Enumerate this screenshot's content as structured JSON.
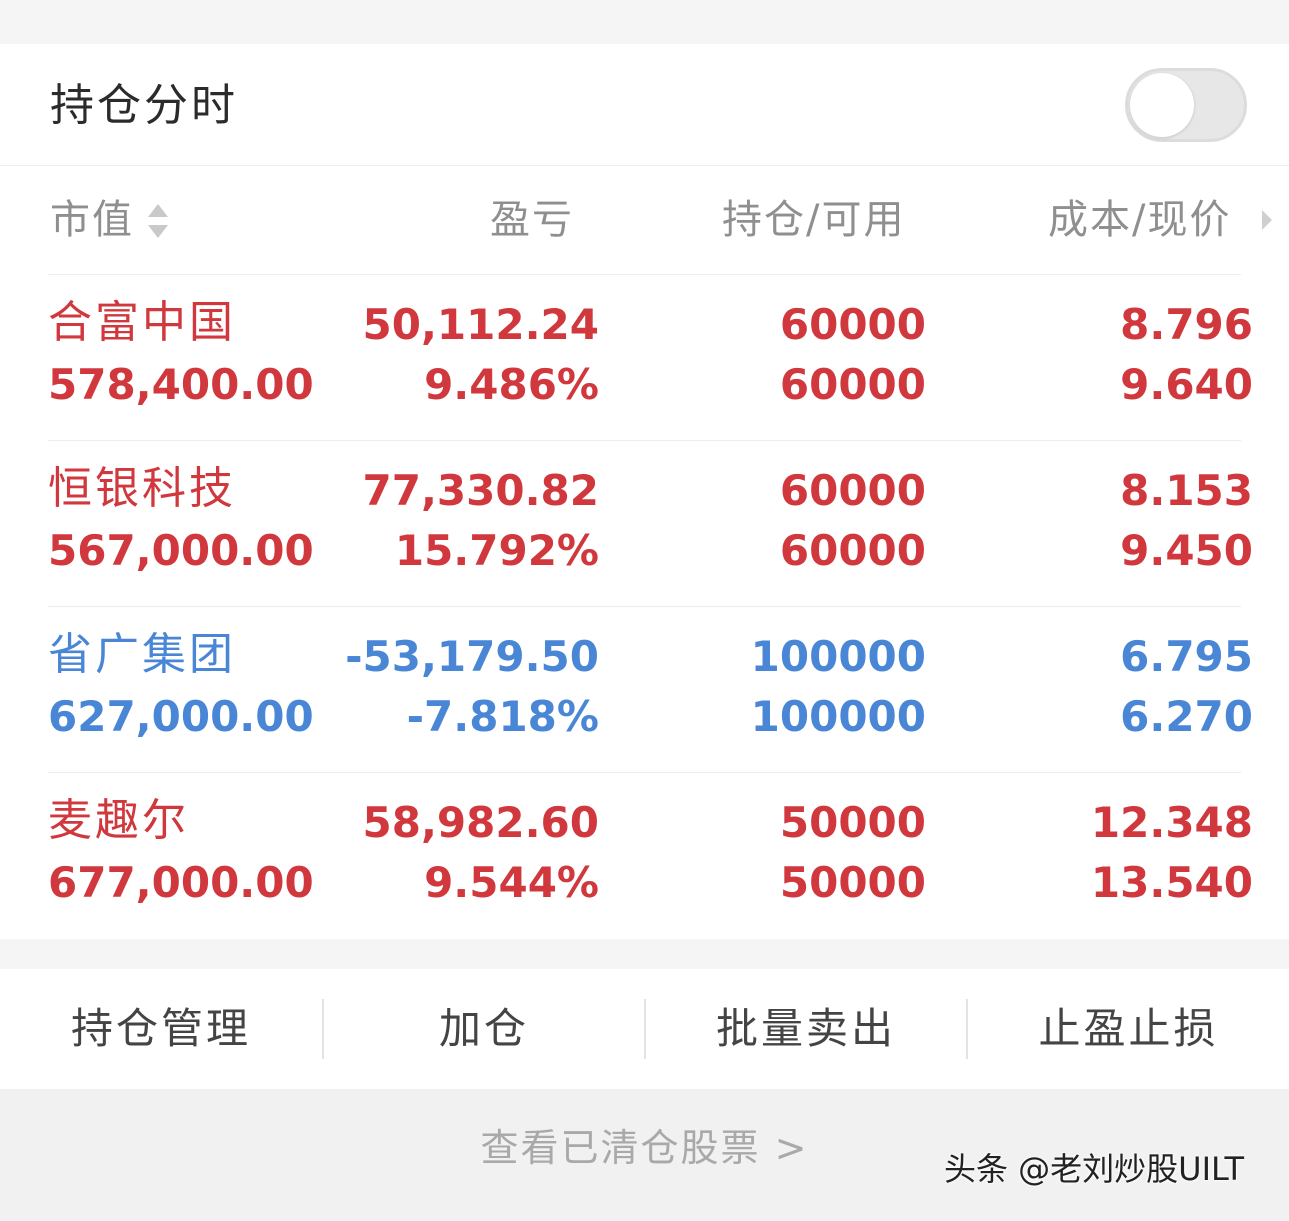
{
  "header": {
    "title": "持仓分时",
    "toggle_on": false
  },
  "columns": {
    "market_value": "市值",
    "pnl": "盈亏",
    "position": "持仓/可用",
    "cost_price": "成本/现价"
  },
  "colors": {
    "up": "#d0383d",
    "down": "#4a86d6"
  },
  "holdings": [
    {
      "name": "合富中国",
      "market_value": "578,400.00",
      "pnl": "50,112.24",
      "pnl_pct": "9.486%",
      "position": "60000",
      "available": "60000",
      "cost": "8.796",
      "price": "9.640",
      "trend": "up"
    },
    {
      "name": "恒银科技",
      "market_value": "567,000.00",
      "pnl": "77,330.82",
      "pnl_pct": "15.792%",
      "position": "60000",
      "available": "60000",
      "cost": "8.153",
      "price": "9.450",
      "trend": "up"
    },
    {
      "name": "省广集团",
      "market_value": "627,000.00",
      "pnl": "-53,179.50",
      "pnl_pct": "-7.818%",
      "position": "100000",
      "available": "100000",
      "cost": "6.795",
      "price": "6.270",
      "trend": "down"
    },
    {
      "name": "麦趣尔",
      "market_value": "677,000.00",
      "pnl": "58,982.60",
      "pnl_pct": "9.544%",
      "position": "50000",
      "available": "50000",
      "cost": "12.348",
      "price": "13.540",
      "trend": "up"
    }
  ],
  "actions": [
    "持仓管理",
    "加仓",
    "批量卖出",
    "止盈止损"
  ],
  "footer": {
    "cleared_link": "查看已清仓股票 >",
    "watermark": "头条 @老刘炒股UILT"
  },
  "icons": {
    "sort": "sort-updown-icon",
    "more": "chevron-right-icon"
  }
}
